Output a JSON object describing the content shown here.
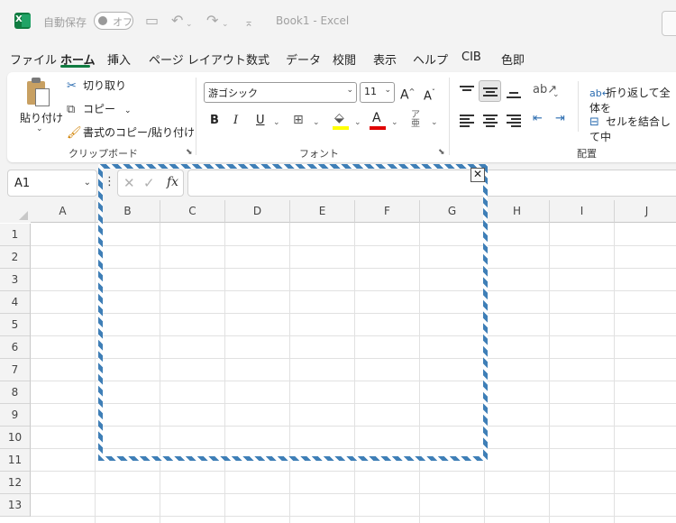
{
  "titlebar": {
    "autosave_label": "自動保存",
    "toggle_text": "オフ",
    "doc_title": "Book1  -  Excel"
  },
  "menu": {
    "items": [
      "ファイル",
      "ホーム",
      "挿入",
      "ページ レイアウト",
      "数式",
      "データ",
      "校閲",
      "表示",
      "ヘルプ",
      "CIB",
      "色即"
    ],
    "active": "ホーム"
  },
  "ribbon": {
    "clipboard": {
      "paste": "貼り付け",
      "cut": "切り取り",
      "copy": "コピー",
      "format_painter": "書式のコピー/貼り付け",
      "group_label": "クリップボード"
    },
    "font": {
      "font_name": "游ゴシック",
      "font_size": "11",
      "bold": "B",
      "italic": "I",
      "underline": "U",
      "font_color_glyph": "A",
      "highlight_color": "#ffff00",
      "font_color": "#e00000",
      "group_label": "フォント"
    },
    "alignment": {
      "wrap_text": "折り返して全体を",
      "merge_center": "セルを結合して中",
      "group_label": "配置"
    }
  },
  "formula_bar": {
    "name_box": "A1",
    "fx": "fx",
    "value": ""
  },
  "grid": {
    "columns": [
      "A",
      "B",
      "C",
      "D",
      "E",
      "F",
      "G",
      "H",
      "I",
      "J"
    ],
    "rows": [
      "1",
      "2",
      "3",
      "4",
      "5",
      "6",
      "7",
      "8",
      "9",
      "10",
      "11",
      "12",
      "13"
    ]
  },
  "overlay": {
    "close_glyph": "✕",
    "border_color": "#3f7fb7"
  }
}
